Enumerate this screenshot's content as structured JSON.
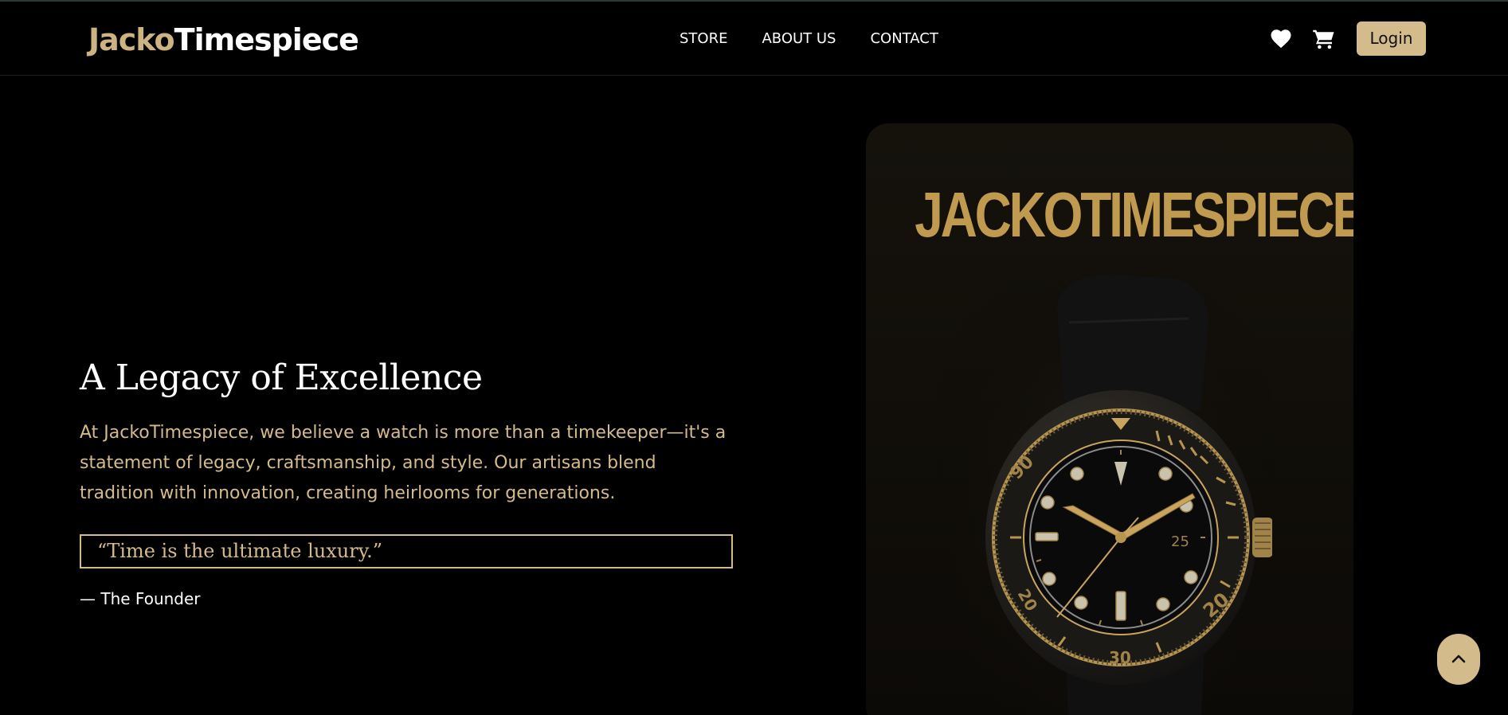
{
  "brand": {
    "part1": "Jacko",
    "part2": "Timespiece",
    "accent_color": "#cdb282"
  },
  "nav": {
    "links": [
      {
        "label": "STORE"
      },
      {
        "label": "ABOUT US"
      },
      {
        "label": "CONTACT"
      }
    ],
    "icons": [
      "heart-icon",
      "cart-icon"
    ],
    "login_label": "Login"
  },
  "hero": {
    "title": "A Legacy of Excellence",
    "description": "At JackoTimespiece, we believe a watch is more than a timekeeper—it's a statement of legacy, craftsmanship, and style. Our artisans blend tradition with innovation, creating heirlooms for generations.",
    "quote": "“Time is the ultimate luxury.”",
    "quote_author": "— The Founder"
  },
  "watch_card": {
    "title": "JACKOTIMESPIECE",
    "dial_markers": [
      "90",
      "20",
      "30",
      "20"
    ],
    "date_window": "25"
  },
  "scroll_top": {
    "icon": "chevron-up-icon"
  },
  "colors": {
    "background": "#000000",
    "gold": "#d4bb8c",
    "card_gold": "#c09a4e",
    "text": "#ffffff"
  }
}
